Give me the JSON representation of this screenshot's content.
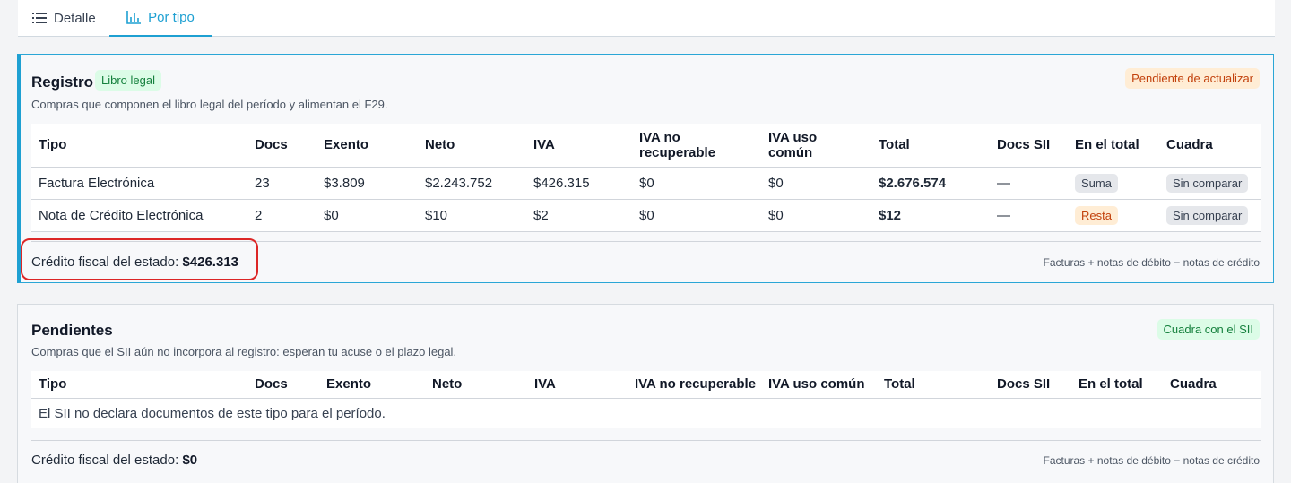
{
  "tabs": [
    {
      "label": "Detalle",
      "icon": "list-icon",
      "active": false
    },
    {
      "label": "Por tipo",
      "icon": "bar-chart-icon",
      "active": true
    }
  ],
  "accent_color": "#1ea0d2",
  "registro": {
    "title": "Registro",
    "badge": "Libro legal",
    "status": "Pendiente de actualizar",
    "subtitle": "Compras que componen el libro legal del período y alimentan el F29.",
    "columns": [
      "Tipo",
      "Docs",
      "Exento",
      "Neto",
      "IVA",
      "IVA no recuperable",
      "IVA uso común",
      "Total",
      "Docs SII",
      "En el total",
      "Cuadra"
    ],
    "rows": [
      {
        "tipo": "Factura Electrónica",
        "docs": "23",
        "exento": "$3.809",
        "neto": "$2.243.752",
        "iva": "$426.315",
        "iva_no_rec": "$0",
        "iva_uso": "$0",
        "total": "$2.676.574",
        "docs_sii": "—",
        "en_total": "Suma",
        "cuadra": "Sin comparar"
      },
      {
        "tipo": "Nota de Crédito Electrónica",
        "docs": "2",
        "exento": "$0",
        "neto": "$10",
        "iva": "$2",
        "iva_no_rec": "$0",
        "iva_uso": "$0",
        "total": "$12",
        "docs_sii": "—",
        "en_total": "Resta",
        "cuadra": "Sin comparar"
      }
    ],
    "credit_label": "Crédito fiscal del estado:",
    "credit_value": "$426.313",
    "note": "Facturas + notas de débito − notas de crédito"
  },
  "pendientes": {
    "title": "Pendientes",
    "status": "Cuadra con el SII",
    "subtitle": "Compras que el SII aún no incorpora al registro: esperan tu acuse o el plazo legal.",
    "columns": [
      "Tipo",
      "Docs",
      "Exento",
      "Neto",
      "IVA",
      "IVA no recuperable",
      "IVA uso común",
      "Total",
      "Docs SII",
      "En el total",
      "Cuadra"
    ],
    "empty_message": "El SII no declara documentos de este tipo para el período.",
    "credit_label": "Crédito fiscal del estado:",
    "credit_value": "$0",
    "note": "Facturas + notas de débito − notas de crédito"
  }
}
